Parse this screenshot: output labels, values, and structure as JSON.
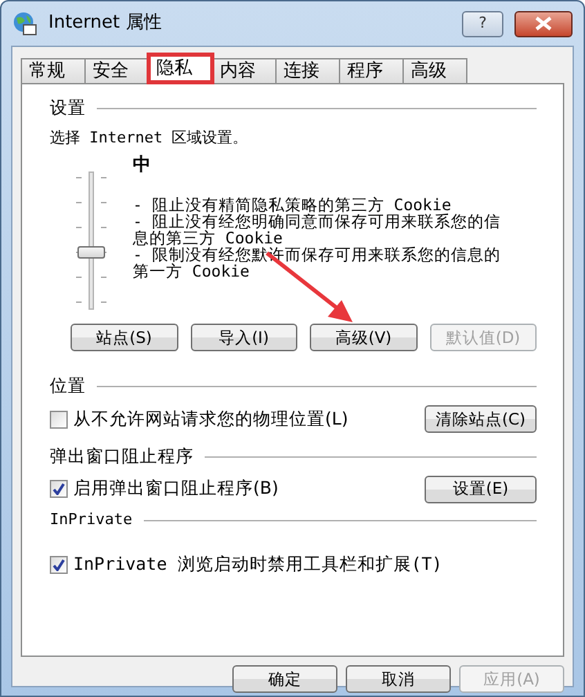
{
  "window": {
    "title": "Internet 属性",
    "help": "?"
  },
  "tabs": [
    {
      "label": "常规",
      "selected": false
    },
    {
      "label": "安全",
      "selected": false
    },
    {
      "label": "隐私",
      "selected": true
    },
    {
      "label": "内容",
      "selected": false
    },
    {
      "label": "连接",
      "selected": false
    },
    {
      "label": "程序",
      "selected": false
    },
    {
      "label": "高级",
      "selected": false
    }
  ],
  "settings": {
    "heading": "设置",
    "prompt": "选择 Internet 区域设置。",
    "level_name": "中",
    "slider": {
      "level": 0.4
    },
    "lines": [
      "- 阻止没有精简隐私策略的第三方 Cookie",
      "- 阻止没有经您明确同意而保存可用来联系您的信息的第三方 Cookie",
      "- 限制没有经您默许而保存可用来联系您的信息的第一方 Cookie"
    ],
    "buttons": [
      {
        "label": "站点(S)",
        "disabled": false
      },
      {
        "label": "导入(I)",
        "disabled": false
      },
      {
        "label": "高级(V)",
        "disabled": false
      },
      {
        "label": "默认值(D)",
        "disabled": true
      }
    ]
  },
  "sections": [
    {
      "heading": "位置",
      "option": {
        "label": "从不允许网站请求您的物理位置(L)",
        "checked": false
      },
      "button": "清除站点(C)"
    },
    {
      "heading": "弹出窗口阻止程序",
      "option": {
        "label": "启用弹出窗口阻止程序(B)",
        "checked": true
      },
      "button": "设置(E)"
    },
    {
      "heading": "InPrivate",
      "option": {
        "label": "InPrivate 浏览启动时禁用工具栏和扩展(T)",
        "checked": true
      }
    }
  ],
  "footer_buttons": [
    {
      "label": "确定",
      "disabled": false
    },
    {
      "label": "取消",
      "disabled": false
    },
    {
      "label": "应用(A)",
      "disabled": true
    }
  ]
}
